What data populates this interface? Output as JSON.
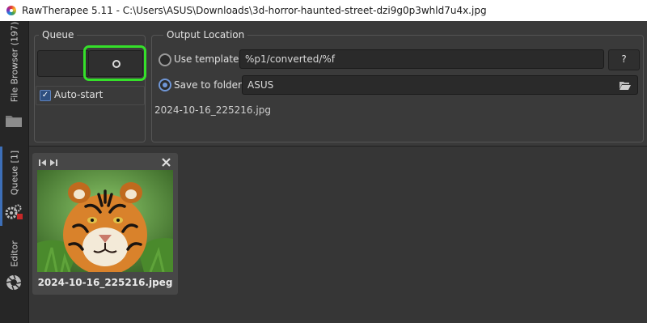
{
  "window": {
    "title": "RawTherapee 5.11 - C:\\Users\\ASUS\\Downloads\\3d-horror-haunted-street-dzi9g0p3whld7u4x.jpg"
  },
  "sidebar": {
    "tabs": [
      {
        "label": "File Browser (197)"
      },
      {
        "label": "Queue [1]"
      },
      {
        "label": "Editor"
      }
    ]
  },
  "queue_panel": {
    "title": "Queue",
    "autostart_label": "Auto-start",
    "autostart_checked": true
  },
  "output_location": {
    "title": "Output Location",
    "use_template_label": "Use template:",
    "template_value": "%p1/converted/%f",
    "help_button_label": "?",
    "save_to_folder_label": "Save to folder:",
    "folder_value": "ASUS",
    "selected_option": "save_to_folder",
    "output_filename": "2024-10-16_225216.jpg"
  },
  "queue_items": [
    {
      "filename": "2024-10-16_225216.jpeg"
    }
  ],
  "colors": {
    "highlight": "#35e02a",
    "accent": "#3d6fb8"
  }
}
